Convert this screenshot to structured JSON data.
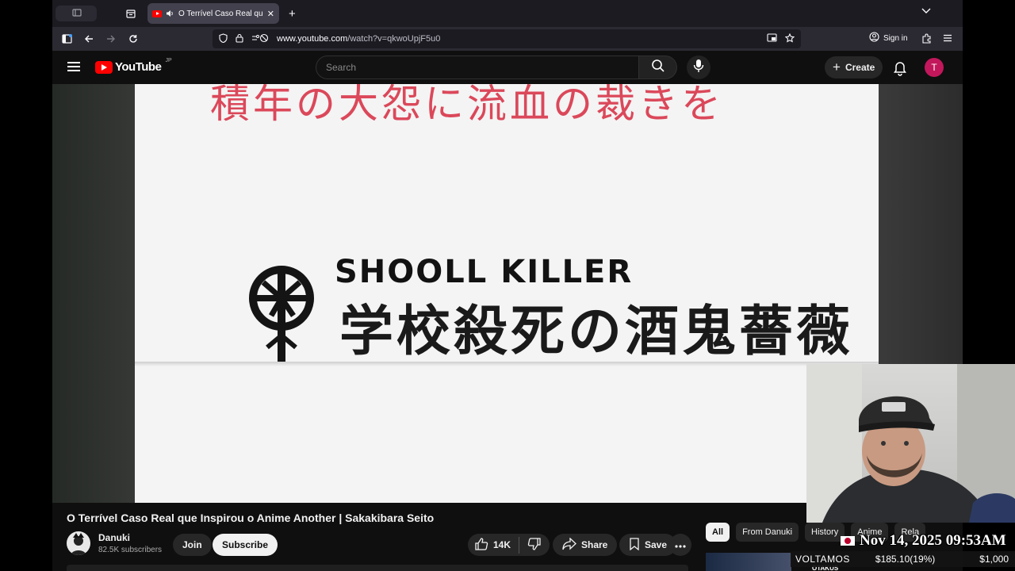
{
  "browser": {
    "tab_title": "O Terrível Caso Real que Inspirou o Anime Another | Sakakibara Seito",
    "url_host": "www.youtube.com",
    "url_path": "/watch?v=qkwoUpjF5u0",
    "signin_label": "Sign in"
  },
  "youtube": {
    "logo_text": "YouTube",
    "region": "JP",
    "search_placeholder": "Search",
    "create_label": "Create",
    "avatar_letter": "T"
  },
  "video_frame": {
    "red_text": "積年の大怨に流血の裁きを",
    "killer_text": "SHOOLL KILLER",
    "kanji_text": "学校殺死の酒鬼薔薇"
  },
  "video": {
    "title": "O Terrível Caso Real que Inspirou o Anime Another | Sakakibara Seito",
    "channel": "Danuki",
    "subscribers": "82.5K subscribers",
    "join_label": "Join",
    "subscribe_label": "Subscribe",
    "likes": "14K",
    "share_label": "Share",
    "save_label": "Save"
  },
  "chips": [
    "All",
    "From Danuki",
    "History",
    "Anime",
    "Rela"
  ],
  "thumb_text": "OTAKUS",
  "overlay": {
    "datetime": "Nov 14, 2025 09:53AM",
    "ticker_label": "VOLTAMOS",
    "ticker_amount": "$185.10(19%)",
    "ticker_goal": "$1,000"
  },
  "colors": {
    "brand_red": "#ff0000",
    "avatar_bg": "#c2185b"
  }
}
